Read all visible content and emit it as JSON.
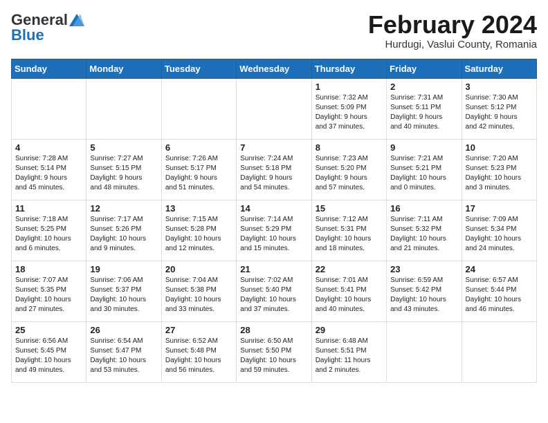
{
  "header": {
    "logo_general": "General",
    "logo_blue": "Blue",
    "month_year": "February 2024",
    "location": "Hurdugi, Vaslui County, Romania"
  },
  "days_of_week": [
    "Sunday",
    "Monday",
    "Tuesday",
    "Wednesday",
    "Thursday",
    "Friday",
    "Saturday"
  ],
  "weeks": [
    [
      {
        "day": "",
        "detail": ""
      },
      {
        "day": "",
        "detail": ""
      },
      {
        "day": "",
        "detail": ""
      },
      {
        "day": "",
        "detail": ""
      },
      {
        "day": "1",
        "detail": "Sunrise: 7:32 AM\nSunset: 5:09 PM\nDaylight: 9 hours\nand 37 minutes."
      },
      {
        "day": "2",
        "detail": "Sunrise: 7:31 AM\nSunset: 5:11 PM\nDaylight: 9 hours\nand 40 minutes."
      },
      {
        "day": "3",
        "detail": "Sunrise: 7:30 AM\nSunset: 5:12 PM\nDaylight: 9 hours\nand 42 minutes."
      }
    ],
    [
      {
        "day": "4",
        "detail": "Sunrise: 7:28 AM\nSunset: 5:14 PM\nDaylight: 9 hours\nand 45 minutes."
      },
      {
        "day": "5",
        "detail": "Sunrise: 7:27 AM\nSunset: 5:15 PM\nDaylight: 9 hours\nand 48 minutes."
      },
      {
        "day": "6",
        "detail": "Sunrise: 7:26 AM\nSunset: 5:17 PM\nDaylight: 9 hours\nand 51 minutes."
      },
      {
        "day": "7",
        "detail": "Sunrise: 7:24 AM\nSunset: 5:18 PM\nDaylight: 9 hours\nand 54 minutes."
      },
      {
        "day": "8",
        "detail": "Sunrise: 7:23 AM\nSunset: 5:20 PM\nDaylight: 9 hours\nand 57 minutes."
      },
      {
        "day": "9",
        "detail": "Sunrise: 7:21 AM\nSunset: 5:21 PM\nDaylight: 10 hours\nand 0 minutes."
      },
      {
        "day": "10",
        "detail": "Sunrise: 7:20 AM\nSunset: 5:23 PM\nDaylight: 10 hours\nand 3 minutes."
      }
    ],
    [
      {
        "day": "11",
        "detail": "Sunrise: 7:18 AM\nSunset: 5:25 PM\nDaylight: 10 hours\nand 6 minutes."
      },
      {
        "day": "12",
        "detail": "Sunrise: 7:17 AM\nSunset: 5:26 PM\nDaylight: 10 hours\nand 9 minutes."
      },
      {
        "day": "13",
        "detail": "Sunrise: 7:15 AM\nSunset: 5:28 PM\nDaylight: 10 hours\nand 12 minutes."
      },
      {
        "day": "14",
        "detail": "Sunrise: 7:14 AM\nSunset: 5:29 PM\nDaylight: 10 hours\nand 15 minutes."
      },
      {
        "day": "15",
        "detail": "Sunrise: 7:12 AM\nSunset: 5:31 PM\nDaylight: 10 hours\nand 18 minutes."
      },
      {
        "day": "16",
        "detail": "Sunrise: 7:11 AM\nSunset: 5:32 PM\nDaylight: 10 hours\nand 21 minutes."
      },
      {
        "day": "17",
        "detail": "Sunrise: 7:09 AM\nSunset: 5:34 PM\nDaylight: 10 hours\nand 24 minutes."
      }
    ],
    [
      {
        "day": "18",
        "detail": "Sunrise: 7:07 AM\nSunset: 5:35 PM\nDaylight: 10 hours\nand 27 minutes."
      },
      {
        "day": "19",
        "detail": "Sunrise: 7:06 AM\nSunset: 5:37 PM\nDaylight: 10 hours\nand 30 minutes."
      },
      {
        "day": "20",
        "detail": "Sunrise: 7:04 AM\nSunset: 5:38 PM\nDaylight: 10 hours\nand 33 minutes."
      },
      {
        "day": "21",
        "detail": "Sunrise: 7:02 AM\nSunset: 5:40 PM\nDaylight: 10 hours\nand 37 minutes."
      },
      {
        "day": "22",
        "detail": "Sunrise: 7:01 AM\nSunset: 5:41 PM\nDaylight: 10 hours\nand 40 minutes."
      },
      {
        "day": "23",
        "detail": "Sunrise: 6:59 AM\nSunset: 5:42 PM\nDaylight: 10 hours\nand 43 minutes."
      },
      {
        "day": "24",
        "detail": "Sunrise: 6:57 AM\nSunset: 5:44 PM\nDaylight: 10 hours\nand 46 minutes."
      }
    ],
    [
      {
        "day": "25",
        "detail": "Sunrise: 6:56 AM\nSunset: 5:45 PM\nDaylight: 10 hours\nand 49 minutes."
      },
      {
        "day": "26",
        "detail": "Sunrise: 6:54 AM\nSunset: 5:47 PM\nDaylight: 10 hours\nand 53 minutes."
      },
      {
        "day": "27",
        "detail": "Sunrise: 6:52 AM\nSunset: 5:48 PM\nDaylight: 10 hours\nand 56 minutes."
      },
      {
        "day": "28",
        "detail": "Sunrise: 6:50 AM\nSunset: 5:50 PM\nDaylight: 10 hours\nand 59 minutes."
      },
      {
        "day": "29",
        "detail": "Sunrise: 6:48 AM\nSunset: 5:51 PM\nDaylight: 11 hours\nand 2 minutes."
      },
      {
        "day": "",
        "detail": ""
      },
      {
        "day": "",
        "detail": ""
      }
    ]
  ]
}
